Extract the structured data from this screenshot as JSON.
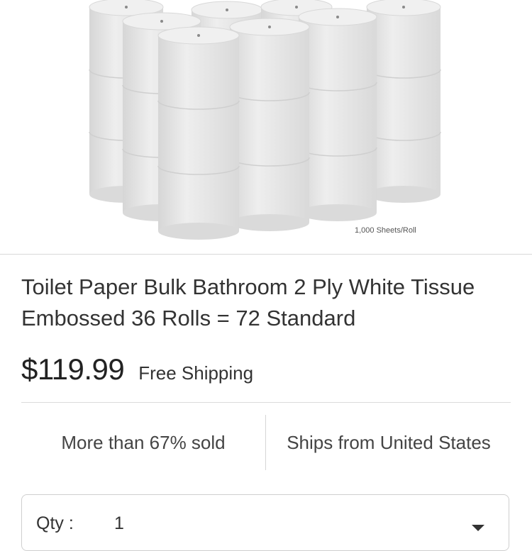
{
  "product_image": {
    "description_icon": "toilet-paper-rolls-image",
    "caption": "1,000 Sheets/Roll"
  },
  "product": {
    "title": "Toilet Paper Bulk Bathroom 2 Ply White Tissue Embossed 36 Rolls = 72 Standard",
    "price": "$119.99",
    "shipping": "Free Shipping"
  },
  "info": {
    "sold": "More than 67% sold",
    "ships_from": "Ships from United States"
  },
  "quantity": {
    "label": "Qty :",
    "value": "1",
    "caret_icon": "chevron-down-icon"
  },
  "colors": {
    "roll_face": "#e6e6e6",
    "roll_top": "#f0f0f0",
    "roll_edge": "#cfcfcf",
    "text": "#333333",
    "divider": "#dcdcdc"
  }
}
